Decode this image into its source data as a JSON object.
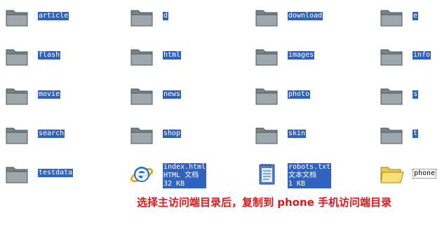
{
  "items": [
    {
      "name": "article",
      "type": "folder"
    },
    {
      "name": "d",
      "type": "folder"
    },
    {
      "name": "download",
      "type": "folder"
    },
    {
      "name": "e",
      "type": "folder"
    },
    {
      "name": "flash",
      "type": "folder"
    },
    {
      "name": "html",
      "type": "folder"
    },
    {
      "name": "images",
      "type": "folder"
    },
    {
      "name": "info",
      "type": "folder"
    },
    {
      "name": "movie",
      "type": "folder"
    },
    {
      "name": "news",
      "type": "folder"
    },
    {
      "name": "photo",
      "type": "folder"
    },
    {
      "name": "s",
      "type": "folder"
    },
    {
      "name": "search",
      "type": "folder"
    },
    {
      "name": "shop",
      "type": "folder"
    },
    {
      "name": "skin",
      "type": "folder"
    },
    {
      "name": "t",
      "type": "folder"
    },
    {
      "name": "testdata",
      "type": "folder"
    },
    {
      "name": "index.html",
      "type": "ie-file",
      "kind": "HTML 文档",
      "size": "32 KB"
    },
    {
      "name": "robots.txt",
      "type": "text-file",
      "kind": "文本文档",
      "size": "1 KB"
    },
    {
      "name": "phone",
      "type": "open-folder"
    }
  ],
  "caption": "选择主访问端目录后，复制到 phone 手机访问端目录",
  "colors": {
    "selection": "#2f63c0",
    "caption": "#e01818"
  }
}
